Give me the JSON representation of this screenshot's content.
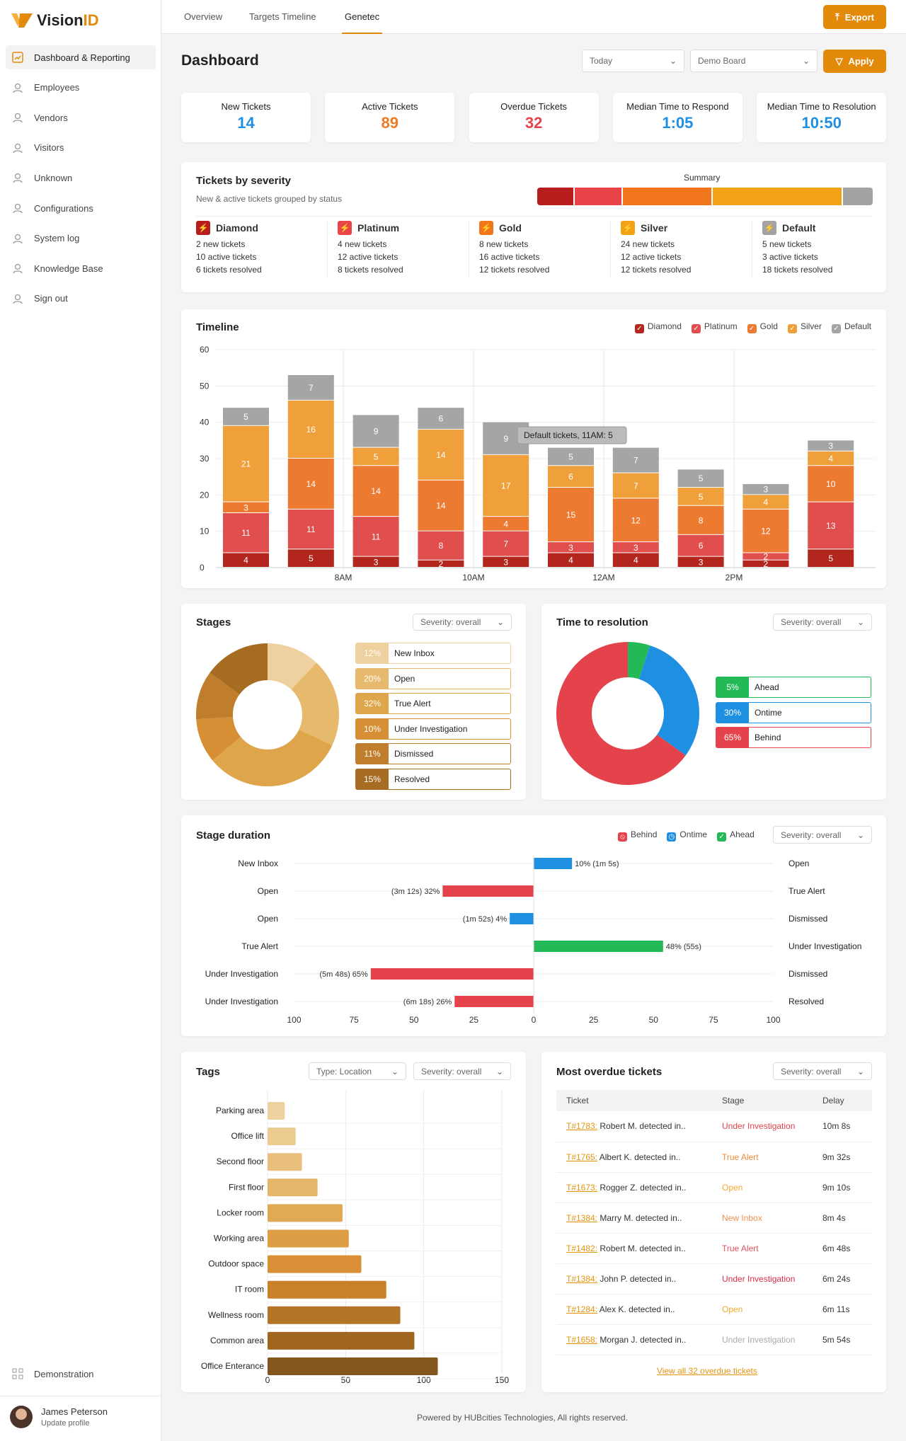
{
  "app": {
    "logo_text": "Vision",
    "logo_accent": "ID"
  },
  "sidebar": {
    "items": [
      {
        "label": "Dashboard & Reporting",
        "icon": "chart-icon",
        "active": true
      },
      {
        "label": "Employees",
        "icon": "face-scan-icon"
      },
      {
        "label": "Vendors",
        "icon": "hierarchy-icon"
      },
      {
        "label": "Visitors",
        "icon": "badge-icon"
      },
      {
        "label": "Unknown",
        "icon": "unknown-user-icon"
      },
      {
        "label": "Configurations",
        "icon": "sliders-icon"
      },
      {
        "label": "System log",
        "icon": "log-icon"
      },
      {
        "label": "Knowledge Base",
        "icon": "help-icon"
      },
      {
        "label": "Sign out",
        "icon": "sign-out-icon"
      }
    ],
    "demo": "Demonstration",
    "user": {
      "name": "James Peterson",
      "sub": "Update profile"
    }
  },
  "tabs": [
    {
      "label": "Overview"
    },
    {
      "label": "Targets Timeline"
    },
    {
      "label": "Genetec",
      "active": true
    }
  ],
  "header": {
    "export": "Export",
    "title": "Dashboard",
    "date_filter": "Today",
    "board_filter": "Demo Board",
    "apply": "Apply"
  },
  "kpis": [
    {
      "label": "New Tickets",
      "value": "14",
      "color": "#1e8fe1"
    },
    {
      "label": "Active Tickets",
      "value": "89",
      "color": "#f07a22"
    },
    {
      "label": "Overdue Tickets",
      "value": "32",
      "color": "#e5434b"
    },
    {
      "label": "Median Time to Respond",
      "value": "1:05",
      "color": "#1e8fe1"
    },
    {
      "label": "Median Time to Resolution",
      "value": "10:50",
      "color": "#1e8fe1"
    }
  ],
  "severity": {
    "title": "Tickets by severity",
    "subtitle": "New & active tickets grouped by status",
    "summary_label": "Summary",
    "summary_share_pct": [
      11,
      14,
      27,
      39,
      9
    ],
    "levels": [
      {
        "name": "Diamond",
        "color": "#b81d1d",
        "new": "2 new tickets",
        "active": "10 active tickets",
        "resolved": "6 tickets resolved"
      },
      {
        "name": "Platinum",
        "color": "#e8444a",
        "new": "4 new tickets",
        "active": "12 active tickets",
        "resolved": "8 tickets resolved"
      },
      {
        "name": "Gold",
        "color": "#f2771c",
        "new": "8 new tickets",
        "active": "16 active tickets",
        "resolved": "12 tickets resolved"
      },
      {
        "name": "Silver",
        "color": "#f3a115",
        "new": "24 new tickets",
        "active": "12 active tickets",
        "resolved": "12 tickets resolved"
      },
      {
        "name": "Default",
        "color": "#a3a3a3",
        "new": "5 new tickets",
        "active": "3 active tickets",
        "resolved": "18 tickets resolved"
      }
    ]
  },
  "chart_data": [
    {
      "id": "timeline",
      "type": "bar",
      "stacked": true,
      "title": "Timeline",
      "ylim": [
        0,
        60
      ],
      "yticks": [
        "0",
        "10",
        "20",
        "30",
        "40",
        "50",
        "60"
      ],
      "xtick_labels": [
        "8AM",
        "10AM",
        "12AM",
        "2PM"
      ],
      "grid": true,
      "legend": "top-right",
      "series": [
        {
          "name": "Diamond",
          "color": "#b3261e",
          "values": [
            4,
            5,
            3,
            2,
            3,
            4,
            4,
            3,
            2,
            5
          ]
        },
        {
          "name": "Platinum",
          "color": "#e04e4e",
          "values": [
            11,
            11,
            11,
            8,
            7,
            3,
            3,
            6,
            2,
            13
          ]
        },
        {
          "name": "Gold",
          "color": "#ec7b31",
          "values": [
            3,
            14,
            14,
            14,
            4,
            15,
            12,
            8,
            12,
            10
          ]
        },
        {
          "name": "Silver",
          "color": "#f0a03a",
          "values": [
            21,
            16,
            5,
            14,
            17,
            6,
            7,
            5,
            4,
            4
          ]
        },
        {
          "name": "Default",
          "color": "#a5a5a5",
          "values": [
            5,
            7,
            9,
            6,
            9,
            5,
            7,
            5,
            3,
            3
          ]
        }
      ],
      "tooltip": "Default tickets, 11AM: 5"
    },
    {
      "id": "stages",
      "type": "pie",
      "title": "Stages",
      "filter": "Severity: overall",
      "slices": [
        {
          "label": "New Inbox",
          "pct": "12%",
          "value": 12,
          "color": "#efd1a0"
        },
        {
          "label": "Open",
          "pct": "20%",
          "value": 20,
          "color": "#e7b96c"
        },
        {
          "label": "True Alert",
          "pct": "32%",
          "value": 32,
          "color": "#dea54b"
        },
        {
          "label": "Under Investigation",
          "pct": "10%",
          "value": 10,
          "color": "#d68f34"
        },
        {
          "label": "Dismissed",
          "pct": "11%",
          "value": 11,
          "color": "#c07d2b"
        },
        {
          "label": "Resolved",
          "pct": "15%",
          "value": 15,
          "color": "#a66c22"
        }
      ]
    },
    {
      "id": "resolution",
      "type": "pie",
      "title": "Time to resolution",
      "filter": "Severity: overall",
      "slices": [
        {
          "label": "Ahead",
          "pct": "5%",
          "value": 5,
          "color": "#22b956"
        },
        {
          "label": "Ontime",
          "pct": "30%",
          "value": 30,
          "color": "#1e8fe1"
        },
        {
          "label": "Behind",
          "pct": "65%",
          "value": 65,
          "color": "#e5434b"
        }
      ]
    },
    {
      "id": "stage_duration",
      "type": "bar",
      "orientation": "horizontal",
      "title": "Stage duration",
      "filter": "Severity: overall",
      "xlim": [
        -100,
        100
      ],
      "xticks": [
        "100",
        "75",
        "50",
        "25",
        "0",
        "25",
        "50",
        "75",
        "100"
      ],
      "legend": [
        {
          "name": "Behind",
          "color": "#e5434b"
        },
        {
          "name": "Ontime",
          "color": "#1e8fe1"
        },
        {
          "name": "Ahead",
          "color": "#22b956"
        }
      ],
      "rows": [
        {
          "from": "New Inbox",
          "to": "Open",
          "value": 16,
          "status": "Ontime",
          "label": "10% (1m 5s)"
        },
        {
          "from": "Open",
          "to": "True Alert",
          "value": -38,
          "status": "Behind",
          "label": "(3m 12s) 32%"
        },
        {
          "from": "Open",
          "to": "Dismissed",
          "value": -10,
          "status": "Ontime",
          "label": "(1m 52s) 4%"
        },
        {
          "from": "True Alert",
          "to": "Under Investigation",
          "value": 54,
          "status": "Ahead",
          "label": "48% (55s)"
        },
        {
          "from": "Under Investigation",
          "to": "Dismissed",
          "value": -68,
          "status": "Behind",
          "label": "(5m 48s) 65%"
        },
        {
          "from": "Under Investigation",
          "to": "Resolved",
          "value": -33,
          "status": "Behind",
          "label": "(6m 18s) 26%"
        }
      ]
    },
    {
      "id": "tags",
      "type": "bar",
      "orientation": "horizontal",
      "title": "Tags",
      "filters": [
        "Type: Location",
        "Severity: overall"
      ],
      "xlim": [
        0,
        150
      ],
      "xticks": [
        "0",
        "50",
        "100",
        "150"
      ],
      "categories": [
        "Parking area",
        "Office lift",
        "Second floor",
        "First floor",
        "Locker room",
        "Working area",
        "Outdoor space",
        "IT room",
        "Wellness room",
        "Common area",
        "Office Enterance"
      ],
      "values": [
        11,
        18,
        22,
        32,
        48,
        52,
        60,
        76,
        85,
        94,
        109
      ],
      "colors": [
        "#efd1a0",
        "#eccb91",
        "#e8bf7d",
        "#e4b56b",
        "#e0aa55",
        "#dd9e45",
        "#d98f35",
        "#c88029",
        "#b47425",
        "#a0661f",
        "#82561c"
      ]
    }
  ],
  "overdue": {
    "title": "Most overdue tickets",
    "filter": "Severity: overall",
    "columns": [
      "Ticket",
      "Stage",
      "Delay"
    ],
    "rows": [
      {
        "id": "T#1783:",
        "desc": " Robert M. detected in..",
        "stage": "Under Investigation",
        "stage_color": "#e0424b",
        "delay": "10m 8s"
      },
      {
        "id": "T#1765:",
        "desc": " Albert K. detected in..",
        "stage": "True Alert",
        "stage_color": "#ec8a3a",
        "delay": "9m 32s"
      },
      {
        "id": "T#1673:",
        "desc": " Rogger Z. detected in..",
        "stage": "Open",
        "stage_color": "#f0aa2c",
        "delay": "9m 10s"
      },
      {
        "id": "T#1384:",
        "desc": " Marry M. detected in..",
        "stage": "New Inbox",
        "stage_color": "#f09152",
        "delay": "8m 4s"
      },
      {
        "id": "T#1482:",
        "desc": " Robert M. detected in..",
        "stage": "True Alert",
        "stage_color": "#e0525a",
        "delay": "6m 48s"
      },
      {
        "id": "T#1384:",
        "desc": " John P. detected in..",
        "stage": "Under Investigation",
        "stage_color": "#d62e4a",
        "delay": "6m 24s"
      },
      {
        "id": "T#1284:",
        "desc": " Alex K. detected in..",
        "stage": "Open",
        "stage_color": "#f0aa2c",
        "delay": "6m 11s"
      },
      {
        "id": "T#1658:",
        "desc": " Morgan J. detected in..",
        "stage": "Under Investigation",
        "stage_color": "#aaaaaa",
        "delay": "5m 54s"
      }
    ],
    "view_all": "View all 32 overdue tickets"
  },
  "footer": "Powered by HUBcities Technologies, All rights reserved."
}
